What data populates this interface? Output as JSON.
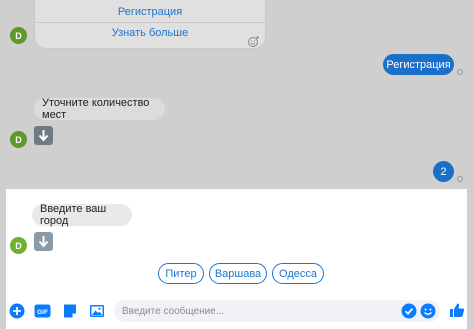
{
  "card": {
    "buttons": [
      {
        "label": "Регистрация"
      },
      {
        "label": "Узнать больше"
      }
    ]
  },
  "avatar_letter": "D",
  "messages": {
    "user_registration": "Регистрация",
    "bot_ask_seats": "Уточните количество мест",
    "user_seats": "2",
    "bot_ask_city": "Введите ваш город"
  },
  "quick_replies": [
    {
      "label": "Питер"
    },
    {
      "label": "Варшава"
    },
    {
      "label": "Одесса"
    }
  ],
  "composer": {
    "placeholder": "Введите сообщение..."
  },
  "icons": {
    "plus": "plus-icon",
    "gif": "gif-icon",
    "sticker": "sticker-icon",
    "image": "image-icon",
    "emoji": "emoji-icon",
    "like": "thumbs-up-icon",
    "arrow": "down-arrow-emoji-icon",
    "react": "add-reaction-icon"
  },
  "gif_label": "GIF",
  "colors": {
    "accent": "#0a7cff",
    "link": "#1b76d1",
    "avatar": "#6fb12f",
    "overlay": "#cfcfcf"
  }
}
